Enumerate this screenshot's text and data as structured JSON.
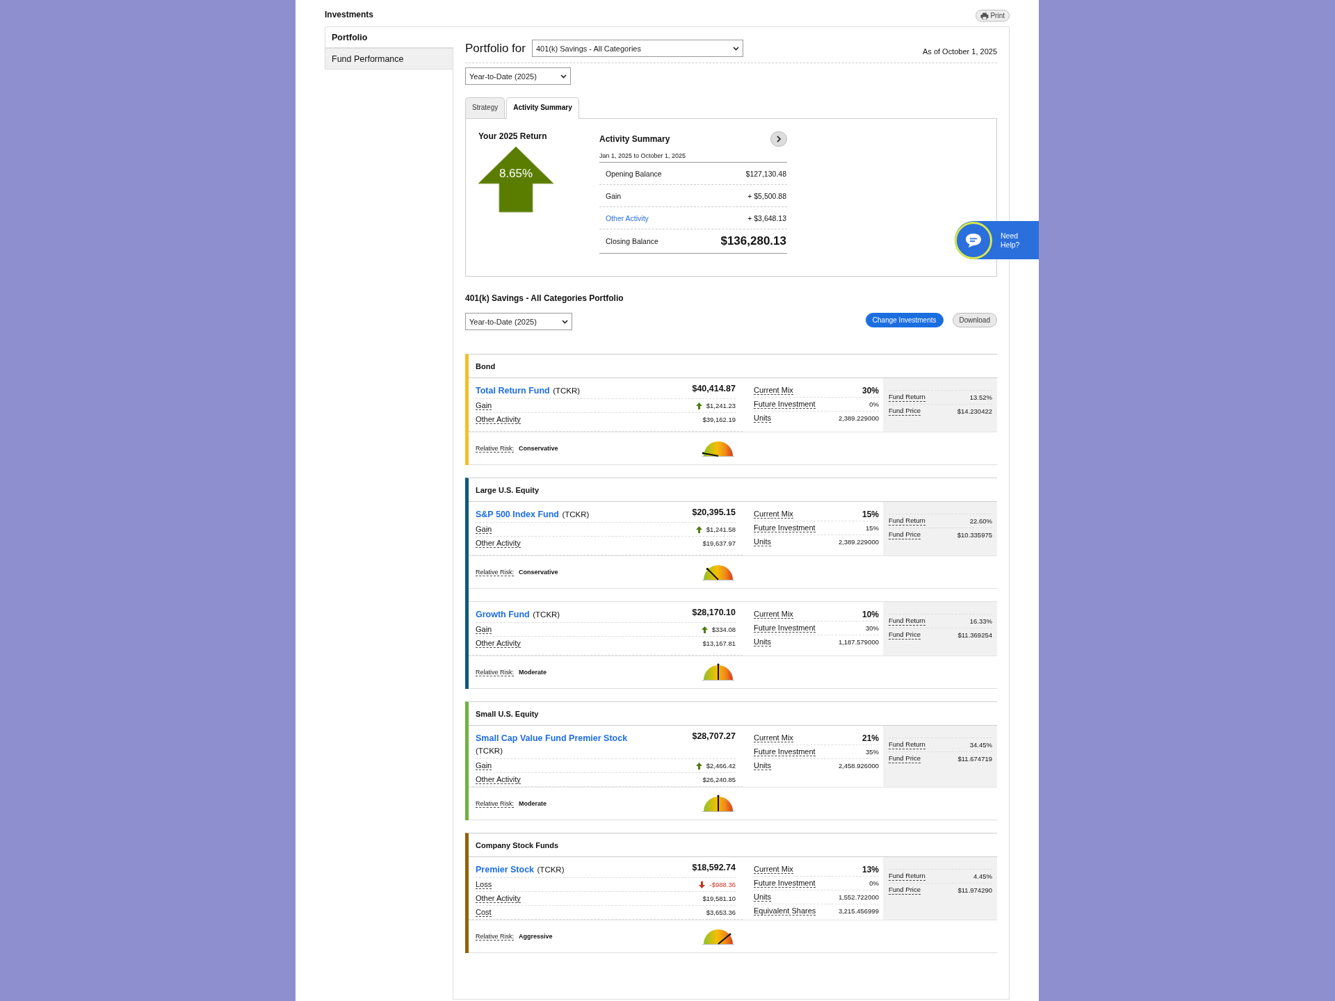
{
  "page_title": "Investments",
  "print_button": "Print",
  "sidebar": {
    "items": [
      {
        "label": "Portfolio",
        "selected": true
      },
      {
        "label": "Fund Performance",
        "selected": false
      }
    ]
  },
  "header": {
    "label": "Portfolio for",
    "plan": "401(k) Savings - All Categories",
    "as_of": "As of October 1, 2025",
    "period": "Year-to-Date (2025)"
  },
  "tabs": [
    {
      "label": "Strategy",
      "selected": false
    },
    {
      "label": "Activity Summary",
      "selected": true
    }
  ],
  "return_panel": {
    "title": "Your 2025 Return",
    "value": "8.65%"
  },
  "activity_summary": {
    "title": "Activity Summary",
    "period": "Jan 1, 2025 to October 1, 2025",
    "rows": [
      {
        "label": "Opening Balance",
        "value": "$127,130.48",
        "kind": "plain"
      },
      {
        "label": "Gain",
        "value": "+ $5,500.88",
        "kind": "plain"
      },
      {
        "label": "Other Activity",
        "value": "+ $3,648.13",
        "kind": "link"
      },
      {
        "label": "Closing Balance",
        "value": "$136,280.13",
        "kind": "total"
      }
    ]
  },
  "portfolio": {
    "title": "401(k) Savings - All Categories Portfolio",
    "period": "Year-to-Date (2025)",
    "buttons": [
      {
        "label": "Change Investments",
        "kind": "primary"
      },
      {
        "label": "Download",
        "kind": "secondary"
      }
    ]
  },
  "groups": [
    {
      "category": "Bond",
      "color": "#f7bd28",
      "funds": [
        {
          "name": "Total Return Fund",
          "ticker": "(TCKR)",
          "balance": "$40,414.87",
          "details": [
            {
              "label": "Gain",
              "value": "$1,241.23",
              "kind": "gain"
            },
            {
              "label": "Other Activity",
              "value": "$39,162.19"
            }
          ],
          "mix": [
            {
              "label": "Current Mix",
              "value": "30%"
            },
            {
              "label": "Future Investment",
              "value": "0%"
            },
            {
              "label": "Units",
              "value": "2,389.229000"
            }
          ],
          "stats": [
            {
              "label": "Fund Return",
              "value": "13.52%"
            },
            {
              "label": "Fund Price",
              "value": "$14.230422"
            }
          ],
          "risk": {
            "label": "Relative Risk:",
            "value": "Conservative",
            "kind": "low"
          }
        }
      ]
    },
    {
      "category": "Large U.S. Equity",
      "color": "#0c5b79",
      "funds": [
        {
          "name": "S&P 500 Index Fund",
          "ticker": "(TCKR)",
          "balance": "$20,395.15",
          "details": [
            {
              "label": "Gain",
              "value": "$1,241.58",
              "kind": "gain"
            },
            {
              "label": "Other Activity",
              "value": "$19,637.97"
            }
          ],
          "mix": [
            {
              "label": "Current Mix",
              "value": "15%"
            },
            {
              "label": "Future Investment",
              "value": "15%"
            },
            {
              "label": "Units",
              "value": "2,389.229000"
            }
          ],
          "stats": [
            {
              "label": "Fund Return",
              "value": "22.60%"
            },
            {
              "label": "Fund Price",
              "value": "$10.335975"
            }
          ],
          "risk": {
            "label": "Relative Risk:",
            "value": "Conservative",
            "kind": "lowmid"
          }
        },
        {
          "name": "Growth Fund",
          "ticker": "(TCKR)",
          "balance": "$28,170.10",
          "details": [
            {
              "label": "Gain",
              "value": "$334.08",
              "kind": "gain"
            },
            {
              "label": "Other Activity",
              "value": "$13,167.81"
            }
          ],
          "mix": [
            {
              "label": "Current Mix",
              "value": "10%"
            },
            {
              "label": "Future Investment",
              "value": "30%"
            },
            {
              "label": "Units",
              "value": "1,187.579000"
            }
          ],
          "stats": [
            {
              "label": "Fund Return",
              "value": "16.33%"
            },
            {
              "label": "Fund Price",
              "value": "$11.369254"
            }
          ],
          "risk": {
            "label": "Relative Risk:",
            "value": "Moderate",
            "kind": "mid"
          }
        }
      ]
    },
    {
      "category": "Small U.S. Equity",
      "color": "#6db33f",
      "funds": [
        {
          "name": "Small Cap Value Fund Premier Stock",
          "ticker": "(TCKR)",
          "balance": "$28,707.27",
          "details": [
            {
              "label": "Gain",
              "value": "$2,466.42",
              "kind": "gain"
            },
            {
              "label": "Other Activity",
              "value": "$26,240.85"
            }
          ],
          "mix": [
            {
              "label": "Current Mix",
              "value": "21%"
            },
            {
              "label": "Future Investment",
              "value": "35%"
            },
            {
              "label": "Units",
              "value": "2,458.926000"
            }
          ],
          "stats": [
            {
              "label": "Fund Return",
              "value": "34.45%"
            },
            {
              "label": "Fund Price",
              "value": "$11.674719"
            }
          ],
          "risk": {
            "label": "Relative Risk:",
            "value": "Moderate",
            "kind": "mid"
          }
        }
      ]
    },
    {
      "category": "Company Stock Funds",
      "color": "#946008",
      "funds": [
        {
          "name": "Premier Stock",
          "ticker": "(TCKR)",
          "balance": "$18,592.74",
          "details": [
            {
              "label": "Loss",
              "value": "-$988.36",
              "kind": "loss"
            },
            {
              "label": "Other Activity",
              "value": "$19,581.10"
            },
            {
              "label": "Cost",
              "value": "$3,653.36"
            }
          ],
          "mix": [
            {
              "label": "Current Mix",
              "value": "13%"
            },
            {
              "label": "Future Investment",
              "value": "0%"
            },
            {
              "label": "Units",
              "value": "1,552.722000"
            },
            {
              "label": "Equivalent Shares",
              "value": "3,215.456999"
            }
          ],
          "stats": [
            {
              "label": "Fund Return",
              "value": "4.45%"
            },
            {
              "label": "Fund Price",
              "value": "$11.974290"
            }
          ],
          "risk": {
            "label": "Relative Risk:",
            "value": "Aggressive",
            "kind": "high"
          }
        }
      ]
    }
  ],
  "help_widget": {
    "label": "Need Help?"
  }
}
